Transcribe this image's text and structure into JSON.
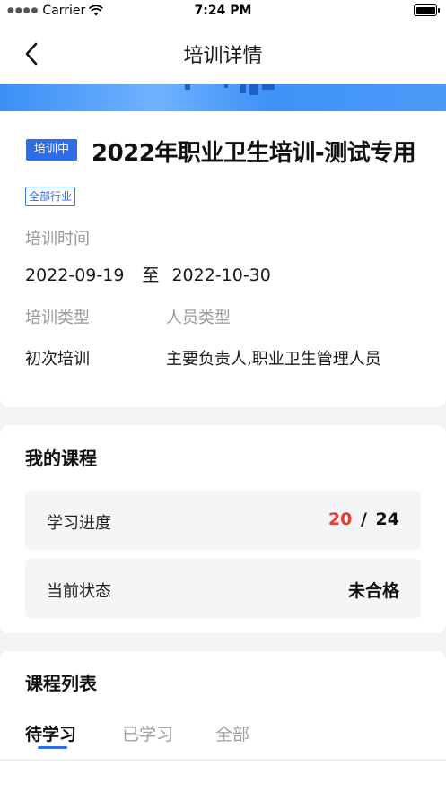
{
  "status_bar": {
    "carrier": "Carrier",
    "time": "7:24 PM"
  },
  "nav": {
    "title": "培训详情"
  },
  "training": {
    "status_tag": "培训中",
    "title": "2022年职业卫生培训-测试专用",
    "industry_tag": "全部行业",
    "time_label": "培训时间",
    "start_date": "2022-09-19",
    "to_label": "至",
    "end_date": "2022-10-30",
    "type_label": "培训类型",
    "type_value": "初次培训",
    "people_label": "人员类型",
    "people_value": "主要负责人,职业卫生管理人员"
  },
  "my_course": {
    "title": "我的课程",
    "progress_label": "学习进度",
    "progress_done": "20",
    "progress_sep": "/",
    "progress_total": "24",
    "status_label": "当前状态",
    "status_value": "未合格"
  },
  "course_list": {
    "title": "课程列表",
    "tabs": [
      {
        "label": "待学习",
        "active": true
      },
      {
        "label": "已学习",
        "active": false
      },
      {
        "label": "全部",
        "active": false
      }
    ]
  },
  "colors": {
    "accent": "#2f6ce5",
    "alert": "#e83a32"
  }
}
